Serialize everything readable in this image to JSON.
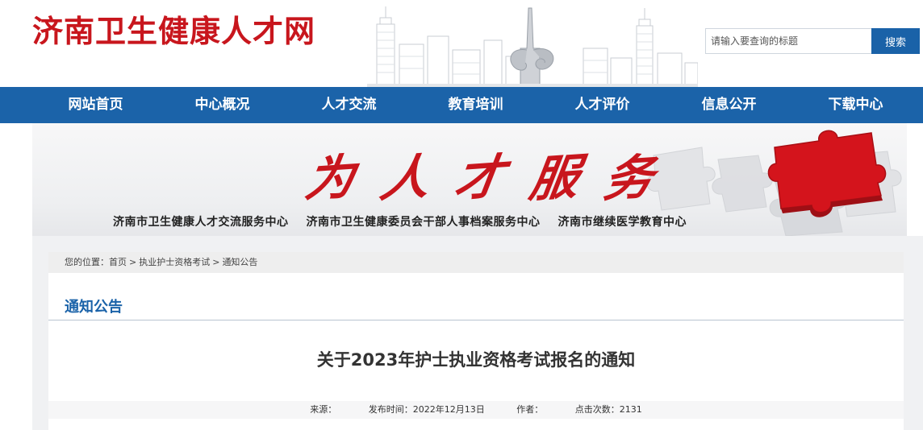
{
  "header": {
    "site_title": "济南卫生健康人才网",
    "search": {
      "placeholder": "请输入要查询的标题",
      "button_label": "搜索"
    }
  },
  "nav": {
    "items": [
      {
        "label": "网站首页"
      },
      {
        "label": "中心概况"
      },
      {
        "label": "人才交流"
      },
      {
        "label": "教育培训"
      },
      {
        "label": "人才评价"
      },
      {
        "label": "信息公开"
      },
      {
        "label": "下载中心"
      }
    ]
  },
  "banner": {
    "slogan": [
      "为",
      "人",
      "才",
      "服",
      "务"
    ],
    "orgs": [
      "济南市卫生健康人才交流服务中心",
      "济南市卫生健康委员会干部人事档案服务中心",
      "济南市继续医学教育中心"
    ]
  },
  "breadcrumb": {
    "prefix": "您的位置：",
    "items": [
      "首页",
      "执业护士资格考试",
      "通知公告"
    ],
    "separator": ">"
  },
  "section": {
    "title": "通知公告"
  },
  "article": {
    "title": "关于2023年护士执业资格考试报名的通知",
    "meta": {
      "source": "来源：",
      "publish_time": "发布时间：2022年12月13日",
      "author": "作者：",
      "views": "点击次数：2131"
    }
  },
  "colors": {
    "brand_red": "#c8161d",
    "nav_blue": "#1b63a9",
    "search_button": "#1a62a8"
  }
}
